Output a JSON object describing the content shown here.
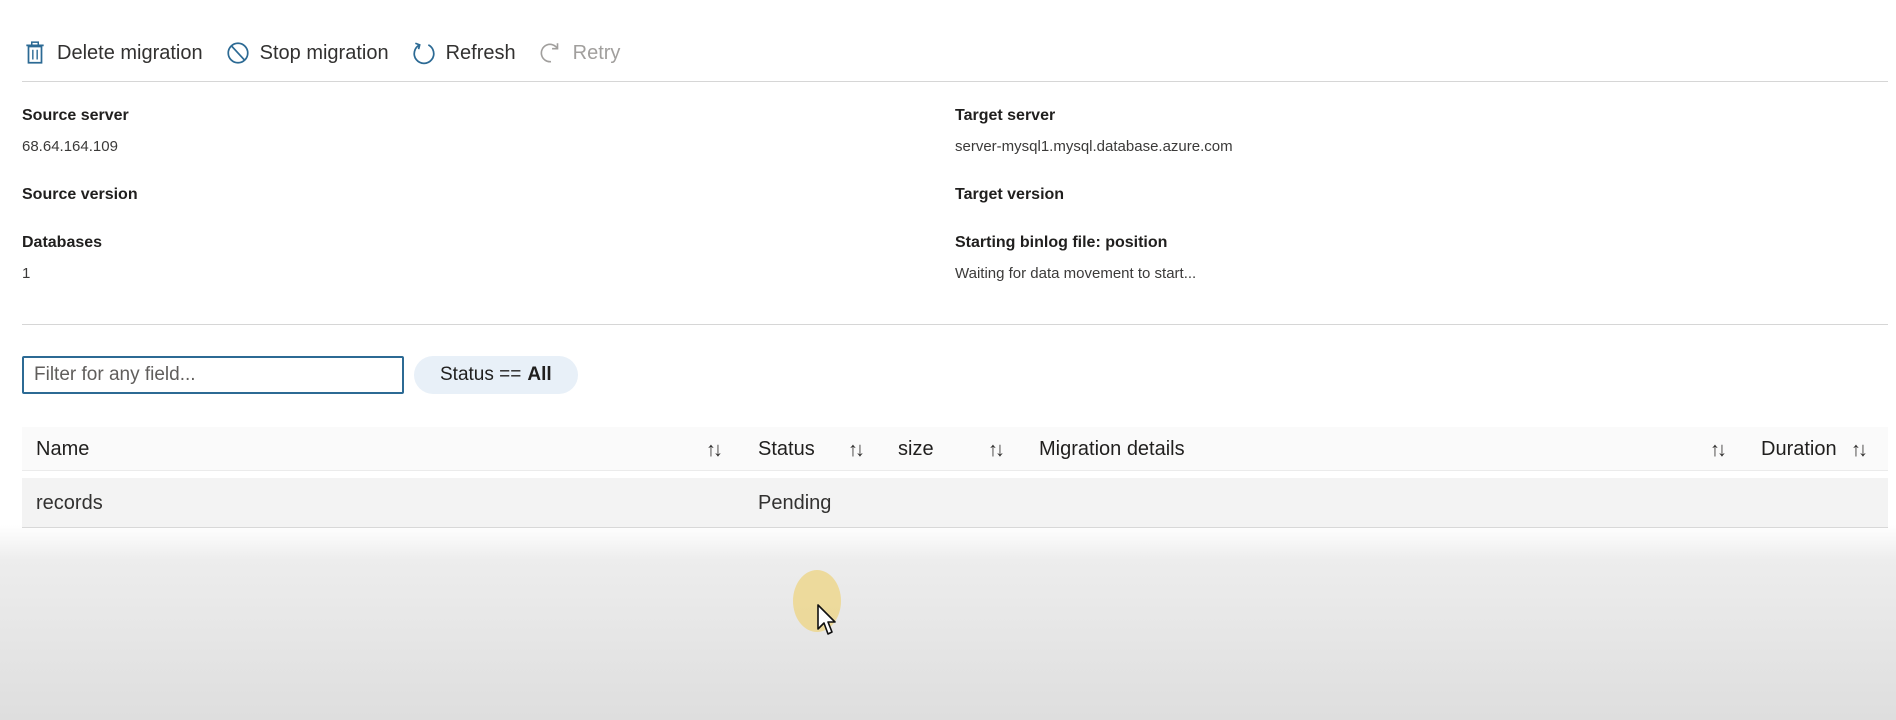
{
  "toolbar": {
    "delete_label": "Delete migration",
    "stop_label": "Stop migration",
    "refresh_label": "Refresh",
    "retry_label": "Retry"
  },
  "details": {
    "source_server_label": "Source server",
    "source_server_value": "68.64.164.109",
    "source_version_label": "Source version",
    "databases_label": "Databases",
    "databases_value": "1",
    "target_server_label": "Target server",
    "target_server_value": "server-mysql1.mysql.database.azure.com",
    "target_version_label": "Target version",
    "binlog_label": "Starting binlog file: position",
    "binlog_value": "Waiting for data movement to start..."
  },
  "filter": {
    "placeholder": "Filter for any field...",
    "status_prefix": "Status ==",
    "status_value": "All"
  },
  "table": {
    "columns": [
      "Name",
      "Status",
      "size",
      "Migration details",
      "Duration"
    ],
    "sort_glyph": "↑↓",
    "rows": [
      {
        "name": "records",
        "status": "Pending",
        "size": "",
        "details": "",
        "duration": ""
      }
    ]
  },
  "colors": {
    "accent": "#2c6a94",
    "pill_bg": "#e8f0f8",
    "disabled_text": "#a19f9d"
  },
  "icons": [
    "trash-icon",
    "block-icon",
    "refresh-icon",
    "retry-icon",
    "mouse-cursor-icon"
  ]
}
